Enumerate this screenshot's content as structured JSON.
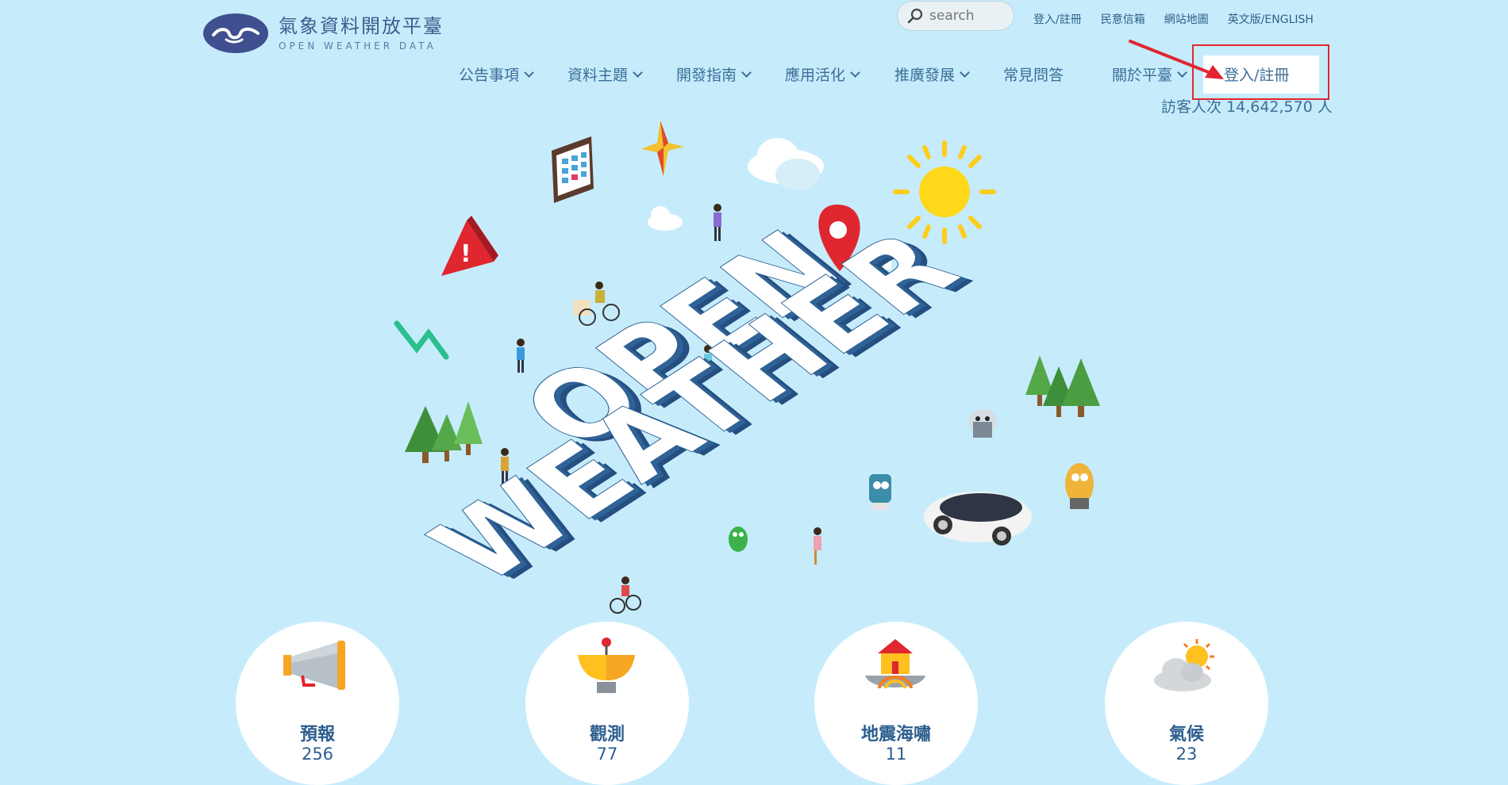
{
  "header": {
    "logo_title": "氣象資料開放平臺",
    "logo_subtitle": "OPEN WEATHER DATA",
    "search_placeholder": "search",
    "top_links": [
      "登入/註冊",
      "民意信箱",
      "網站地圖",
      "英文版/ENGLISH"
    ],
    "nav": [
      {
        "label": "公告事項",
        "dropdown": true
      },
      {
        "label": "資料主題",
        "dropdown": true
      },
      {
        "label": "開發指南",
        "dropdown": true
      },
      {
        "label": "應用活化",
        "dropdown": true
      },
      {
        "label": "推廣發展",
        "dropdown": true
      },
      {
        "label": "常見問答",
        "dropdown": false
      },
      {
        "label": "關於平臺",
        "dropdown": true
      }
    ],
    "login_button": "登入/註冊",
    "visitor_count": "訪客人次 14,642,570 人"
  },
  "hero": {
    "word1": "OPEN",
    "word2": "WEATHER"
  },
  "categories": [
    {
      "label": "預報",
      "count": "256",
      "icon": "megaphone-icon"
    },
    {
      "label": "觀測",
      "count": "77",
      "icon": "radar-dish-icon"
    },
    {
      "label": "地震海嘯",
      "count": "11",
      "icon": "house-earthquake-icon"
    },
    {
      "label": "氣候",
      "count": "23",
      "icon": "sun-cloud-icon"
    }
  ],
  "colors": {
    "background": "#c6ecfb",
    "highlight": "#e22530",
    "text": "#3b6e98"
  }
}
